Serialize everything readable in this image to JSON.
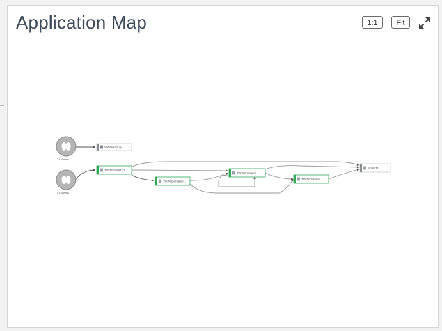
{
  "header": {
    "title": "Application Map",
    "btn_actual_size": "1:1",
    "btn_fit": "Fit",
    "expand_icon": "expand-arrows-icon"
  },
  "colors": {
    "accent_green": "#2eaa58",
    "title": "#3e4b5a",
    "edge": "#9a9a9a",
    "client_fill": "#b5b5b5"
  },
  "clients": [
    {
      "label": "21 clients"
    },
    {
      "label": "41 clients"
    }
  ],
  "nodes": {
    "node_a": "SafeNet/sh sy...",
    "node_b": "TPCN/PortalET1...",
    "node_c": "TPCN/Domain/S...",
    "node_d": "TPCN/Connecti...",
    "node_e": "TPCN/DataFun...",
    "node_f": "Simbl/T1"
  }
}
